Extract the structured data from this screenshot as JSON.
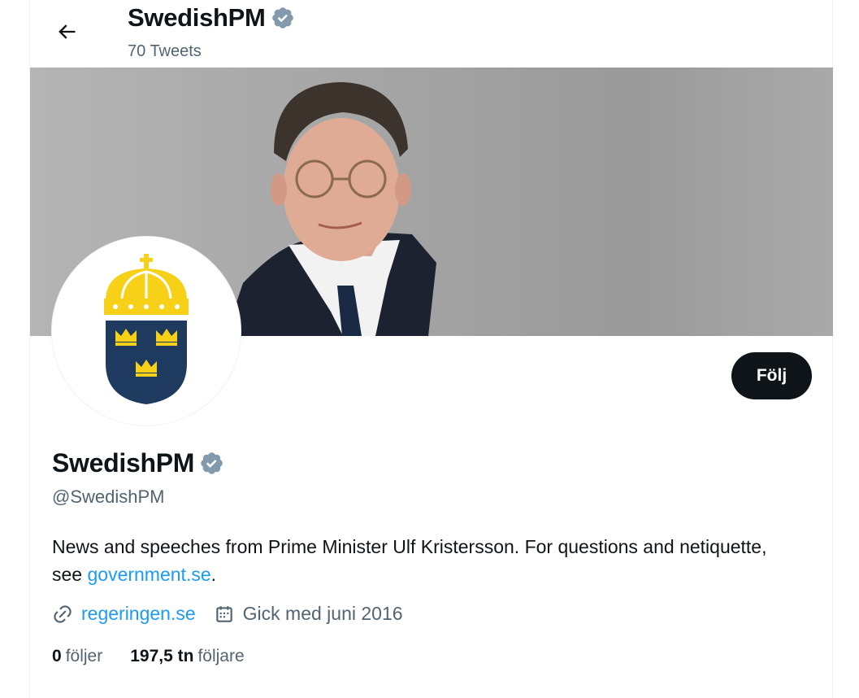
{
  "header": {
    "name": "SwedishPM",
    "tweet_count": "70 Tweets"
  },
  "profile": {
    "name": "SwedishPM",
    "handle": "@SwedishPM",
    "bio_text": "News and speeches from Prime Minister Ulf Kristersson. For questions and netiquette, see ",
    "bio_link": "government.se",
    "bio_end": ".",
    "website": "regeringen.se",
    "joined": "Gick med juni 2016",
    "following_count": "0",
    "following_label": "följer",
    "followers_count": "197,5 tn",
    "followers_label": "följare"
  },
  "actions": {
    "follow_label": "Följ"
  },
  "icons": {
    "back": "arrow-left-icon",
    "verified": "verified-badge-icon",
    "link": "link-icon",
    "calendar": "calendar-icon"
  },
  "colors": {
    "text": "#0f1419",
    "secondary": "#536471",
    "link": "#1d9bf0",
    "button": "#0f1419",
    "crown_gold": "#f7d117",
    "shield_blue": "#1f3a5f"
  }
}
